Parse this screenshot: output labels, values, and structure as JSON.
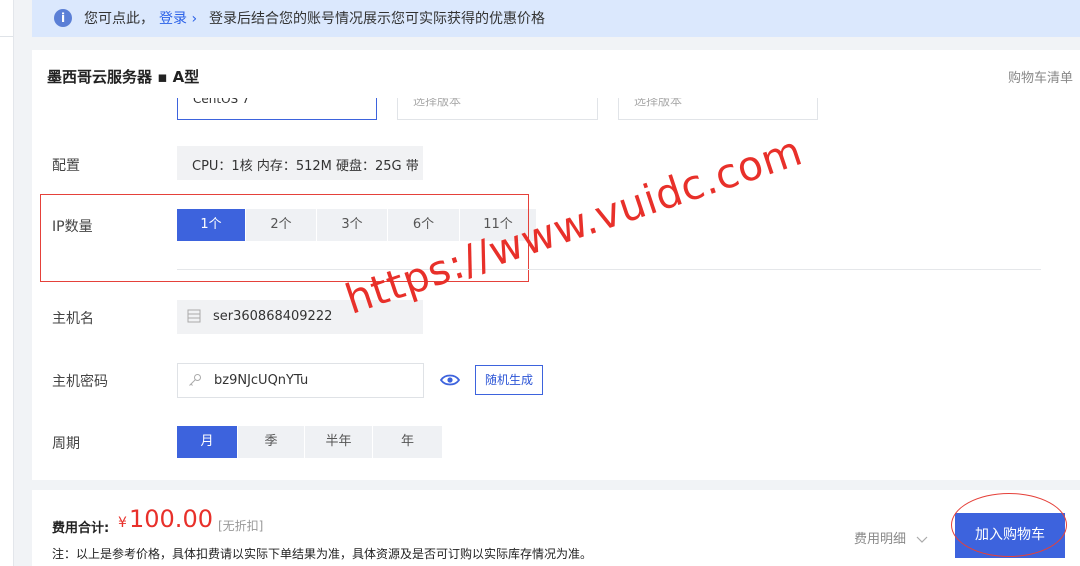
{
  "banner": {
    "text_prefix": "您可点此，",
    "login_label": "登录",
    "chevron": "›",
    "text_suffix": "登录后结合您的账号情况展示您可实际获得的优惠价格",
    "info_icon": "i"
  },
  "header": {
    "title": "墨西哥云服务器 ▪ A型",
    "cart_list": "购物车清单"
  },
  "os": {
    "selected": "CentOS 7",
    "option2_placeholder": "选择版本",
    "option3_placeholder": "选择版本"
  },
  "config": {
    "label": "配置",
    "value": "CPU：1核 内存：512M 硬盘：25G 带"
  },
  "ip": {
    "label": "IP数量",
    "options": [
      "1个",
      "2个",
      "3个",
      "6个",
      "11个"
    ],
    "selected_index": 0
  },
  "hostname": {
    "label": "主机名",
    "value": "ser360868409222"
  },
  "password": {
    "label": "主机密码",
    "value": "bz9NJcUQnYTu",
    "random_button": "随机生成"
  },
  "period": {
    "label": "周期",
    "options": [
      "月",
      "季",
      "半年",
      "年"
    ],
    "selected_index": 0
  },
  "footer": {
    "fee_label": "费用合计:",
    "currency": "¥",
    "price": "100.00",
    "discount_tag": "[无折扣]",
    "note": "注：以上是参考价格，具体扣费请以实际下单结果为准，具体资源及是否可订购以实际库存情况为准。",
    "detail_label": "费用明细",
    "add_to_cart": "加入购物车"
  },
  "watermark": "https://www.vuidc.com",
  "colors": {
    "accent": "#3d63dd",
    "price": "#e8302a",
    "annotation": "#e5413a",
    "banner_bg": "#dbe8fd"
  }
}
